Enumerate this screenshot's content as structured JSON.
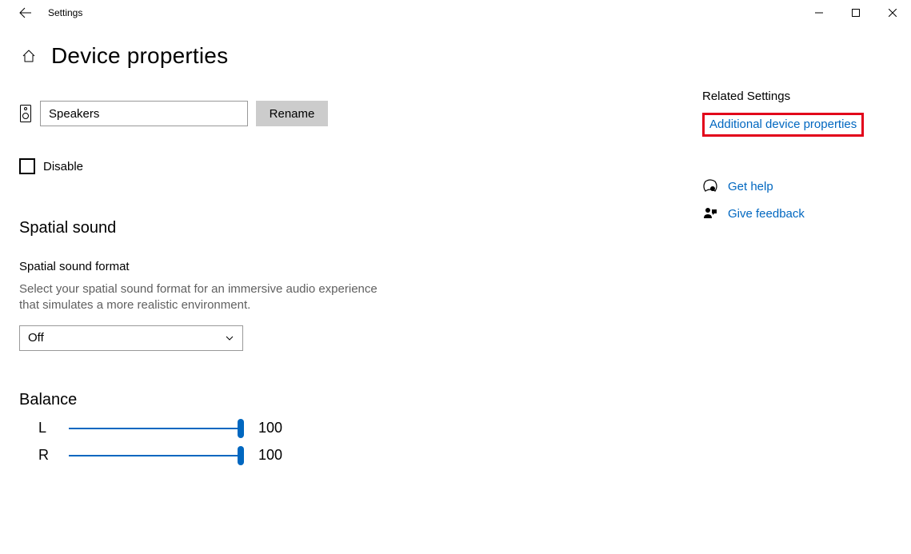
{
  "titlebar": {
    "app_title": "Settings"
  },
  "header": {
    "page_title": "Device properties"
  },
  "device": {
    "name_value": "Speakers",
    "rename_label": "Rename",
    "disable_label": "Disable"
  },
  "spatial": {
    "section_title": "Spatial sound",
    "format_label": "Spatial sound format",
    "format_desc": "Select your spatial sound format for an immersive audio experience that simulates a more realistic environment.",
    "dropdown_value": "Off"
  },
  "balance": {
    "section_title": "Balance",
    "left_label": "L",
    "left_value": "100",
    "right_label": "R",
    "right_value": "100"
  },
  "related": {
    "title": "Related Settings",
    "additional_link": "Additional device properties",
    "help_link": "Get help",
    "feedback_link": "Give feedback"
  }
}
